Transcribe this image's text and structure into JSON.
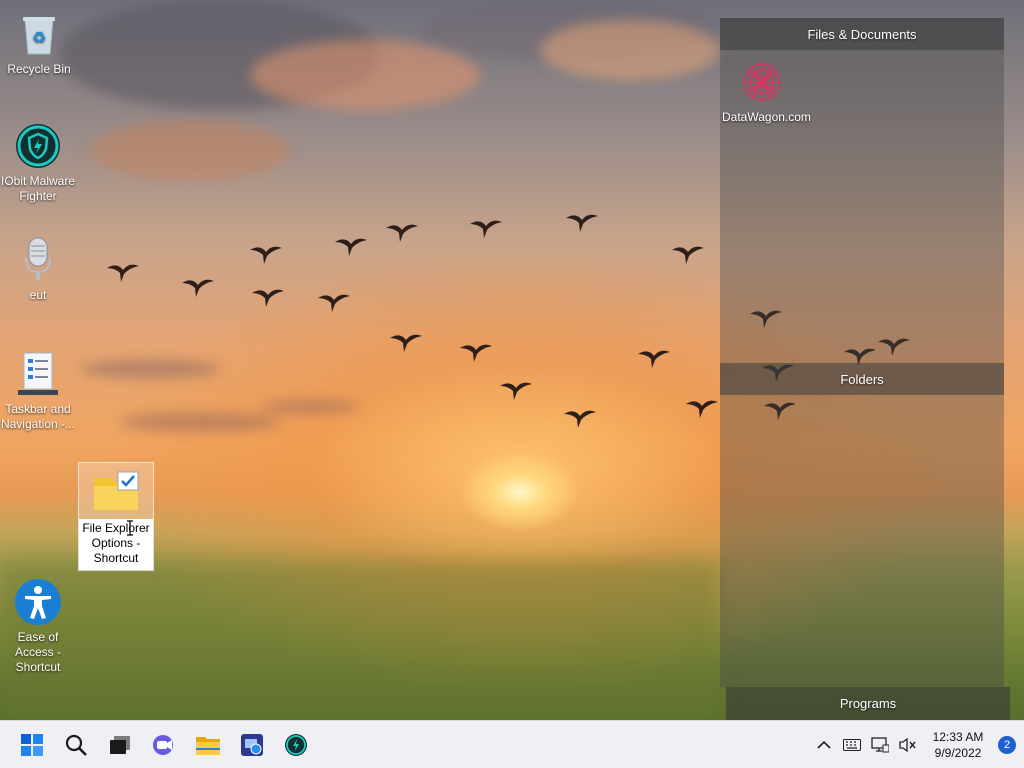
{
  "desktop": {
    "icons": [
      {
        "label": "Recycle Bin",
        "icon": "recycle-bin-icon"
      },
      {
        "label": "IObit Malware Fighter",
        "icon": "iobit-shield-icon"
      },
      {
        "label": "eut",
        "icon": "microphone-icon"
      },
      {
        "label": "Taskbar and Navigation -...",
        "icon": "taskbar-settings-icon"
      },
      {
        "label": "File Explorer Options - Shortcut",
        "icon": "folder-check-icon"
      },
      {
        "label": "Ease of Access - Shortcut",
        "icon": "accessibility-icon"
      }
    ]
  },
  "fences": {
    "files": {
      "title": "Files & Documents",
      "items": [
        {
          "label": "DataWagon.com",
          "icon": "datawagon-logo-icon"
        }
      ]
    },
    "folders": {
      "title": "Folders"
    },
    "programs": {
      "title": "Programs"
    }
  },
  "taskbar": {
    "apps": [
      "windows-start-icon",
      "search-icon",
      "task-view-icon",
      "teams-chat-icon",
      "file-explorer-icon",
      "remote-desktop-icon",
      "iobit-shield-icon"
    ],
    "tray": {
      "time": "12:33 AM",
      "date": "9/9/2022",
      "notifications": "2"
    }
  },
  "colors": {
    "iobit_teal": "#1ec8c0",
    "access_blue": "#1a7fd4",
    "start_blue": "#0a64d8",
    "folder_yellow": "#f4c430"
  }
}
